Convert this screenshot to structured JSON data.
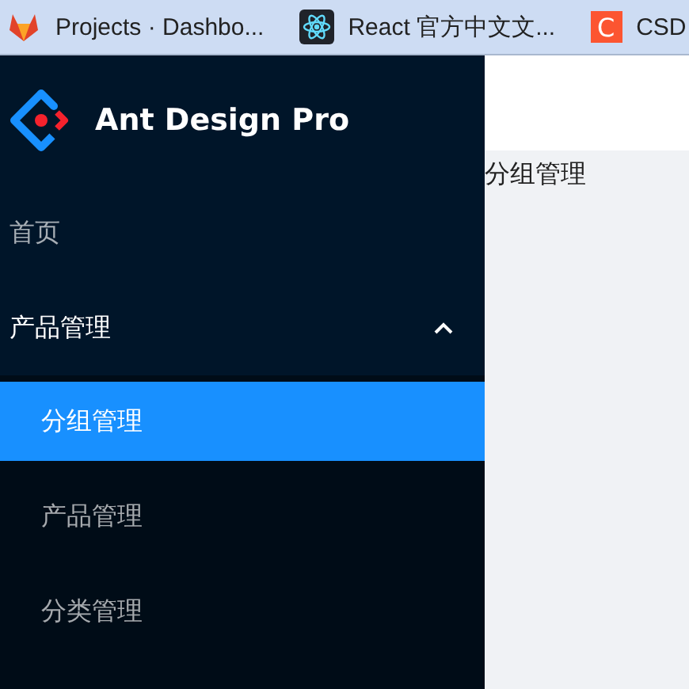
{
  "bookmarks": [
    {
      "label": "Projects · Dashbo...",
      "kind": "fox"
    },
    {
      "label": "React 官方中文文...",
      "kind": "atom"
    },
    {
      "label": "CSD",
      "kind": "letter",
      "icon_text": "C"
    }
  ],
  "sidebar": {
    "title": "Ant Design Pro",
    "items": [
      {
        "label": "首页",
        "selected": false
      },
      {
        "label": "产品管理",
        "selected": false,
        "expanded": true,
        "children": [
          {
            "label": "分组管理",
            "selected": true
          },
          {
            "label": "产品管理",
            "selected": false
          },
          {
            "label": "分类管理",
            "selected": false
          }
        ]
      }
    ]
  },
  "content": {
    "breadcrumb": "分组管理"
  }
}
